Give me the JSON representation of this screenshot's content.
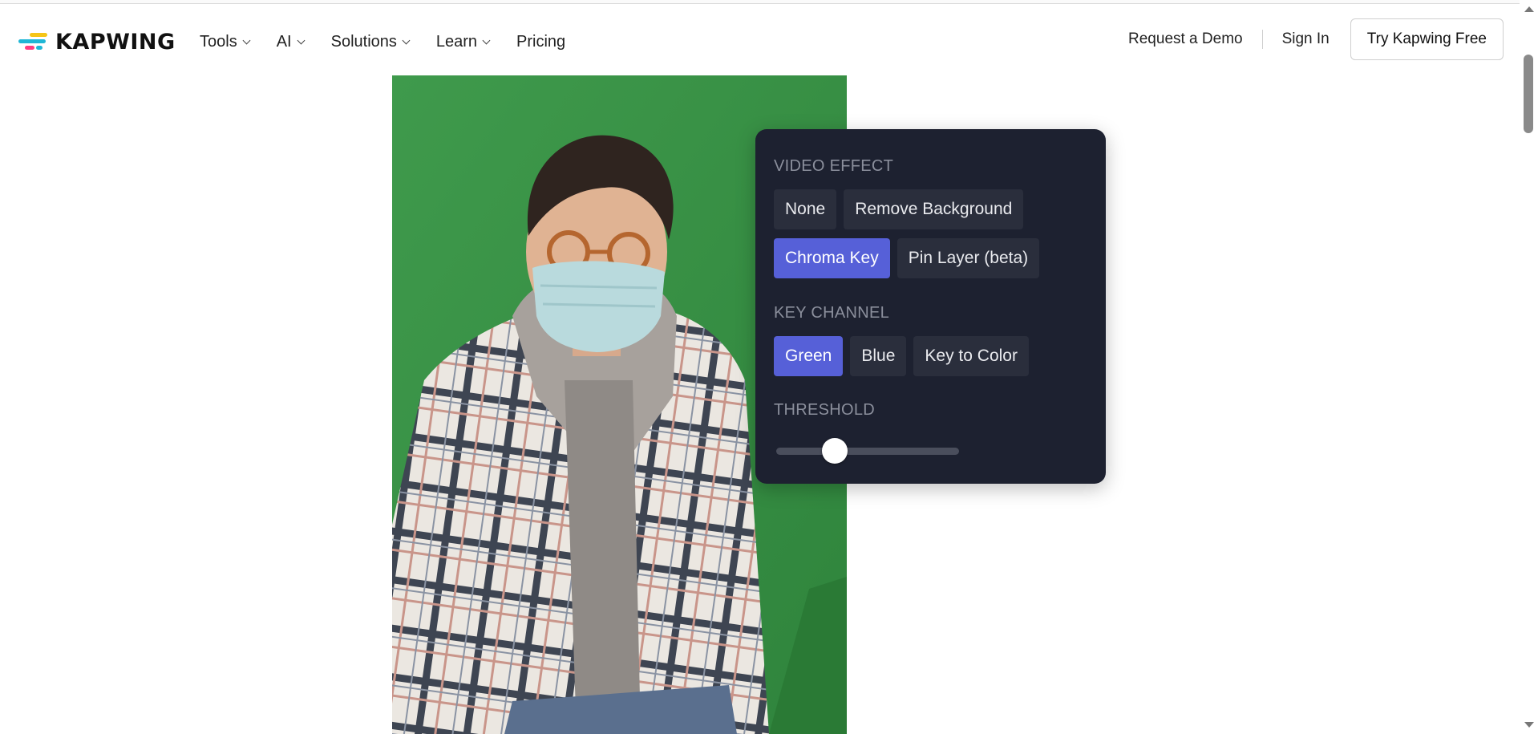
{
  "header": {
    "brand": "KAPWING",
    "nav": [
      {
        "label": "Tools",
        "has_dropdown": true
      },
      {
        "label": "AI",
        "has_dropdown": true
      },
      {
        "label": "Solutions",
        "has_dropdown": true
      },
      {
        "label": "Learn",
        "has_dropdown": true
      },
      {
        "label": "Pricing",
        "has_dropdown": false
      }
    ],
    "request_demo": "Request a Demo",
    "sign_in": "Sign In",
    "cta": "Try Kapwing Free"
  },
  "effects_panel": {
    "video_effect_label": "VIDEO EFFECT",
    "video_effect_options": [
      "None",
      "Remove Background",
      "Chroma Key",
      "Pin Layer (beta)"
    ],
    "video_effect_selected": "Chroma Key",
    "key_channel_label": "KEY CHANNEL",
    "key_channel_options": [
      "Green",
      "Blue",
      "Key to Color"
    ],
    "key_channel_selected": "Green",
    "threshold_label": "THRESHOLD",
    "threshold_value_fraction": 0.32
  },
  "colors": {
    "panel_bg": "#1d2130",
    "accent": "#5660d8",
    "green_screen": "#3b9447"
  }
}
